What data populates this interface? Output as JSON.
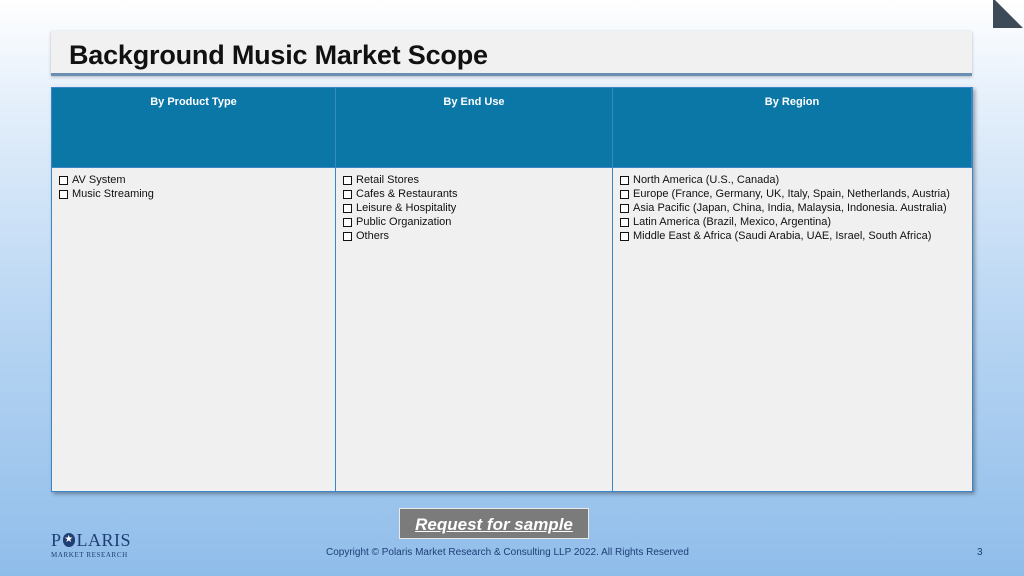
{
  "title": "Background Music Market Scope",
  "table": {
    "headers": [
      "By Product Type",
      "By End Use",
      "By Region"
    ],
    "columns": [
      [
        "AV System",
        "Music Streaming"
      ],
      [
        "Retail Stores",
        "Cafes & Restaurants",
        "Leisure & Hospitality",
        "Public Organization",
        "Others"
      ],
      [
        "North America (U.S., Canada)",
        "Europe (France, Germany, UK, Italy, Spain, Netherlands, Austria)",
        "Asia Pacific (Japan, China, India, Malaysia, Indonesia. Australia)",
        "Latin America (Brazil, Mexico, Argentina)",
        "Middle East & Africa (Saudi Arabia, UAE, Israel, South Africa)"
      ]
    ]
  },
  "cta": {
    "label": "Request for sample"
  },
  "logo": {
    "name_left": "P",
    "name_right": "LARIS",
    "subtitle": "MARKET RESEARCH"
  },
  "footer": {
    "copyright": "Copyright © Polaris Market Research & Consulting LLP 2022. All Rights Reserved",
    "page_number": "3"
  },
  "colors": {
    "header_bg": "#0a77a7",
    "border": "#3a86c6",
    "logo": "#1f3e74"
  }
}
